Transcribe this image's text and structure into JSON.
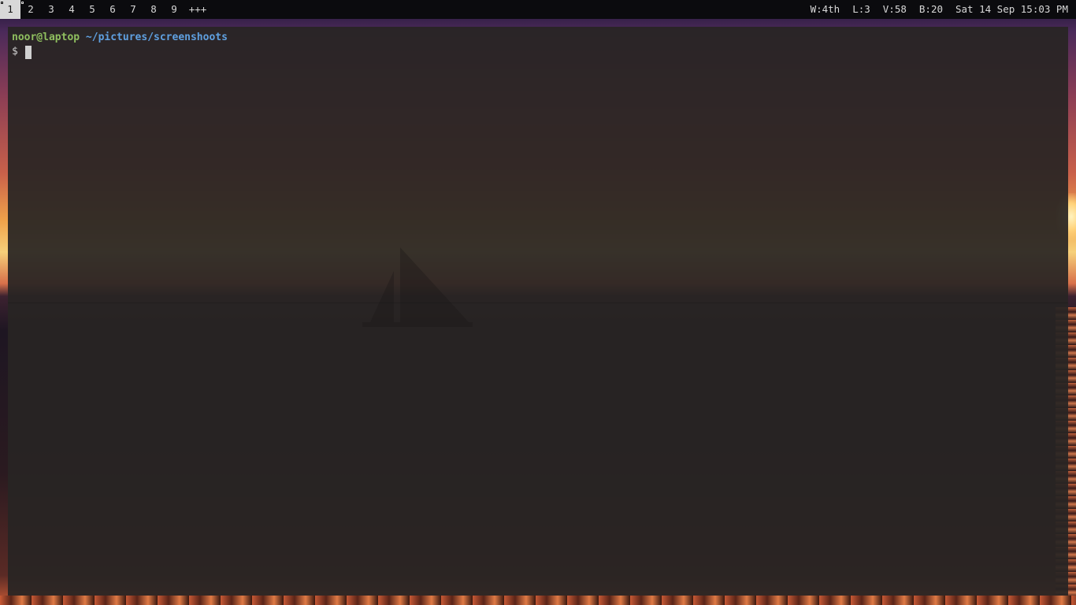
{
  "statusbar": {
    "workspaces": [
      {
        "label": "1",
        "active": true
      },
      {
        "label": "2",
        "active": false
      },
      {
        "label": "3",
        "active": false
      },
      {
        "label": "4",
        "active": false
      },
      {
        "label": "5",
        "active": false
      },
      {
        "label": "6",
        "active": false
      },
      {
        "label": "7",
        "active": false
      },
      {
        "label": "8",
        "active": false
      },
      {
        "label": "9",
        "active": false
      }
    ],
    "more_label": "+++",
    "wireless": "W:4th",
    "load": "L:3",
    "volume": "V:58",
    "battery": "B:20",
    "datetime": "Sat 14 Sep 15:03 PM"
  },
  "terminal": {
    "user_host": "noor@laptop",
    "cwd": "~/pictures/screenshoots",
    "prompt_symbol": "$"
  },
  "colors": {
    "user": "#8fbf5f",
    "path": "#5fa0e0",
    "bar_bg": "#0b0b0e",
    "terminal_bg": "#282524"
  },
  "wallpaper": {
    "description_icon": "sunset-sea-sailboat-wallpaper"
  }
}
